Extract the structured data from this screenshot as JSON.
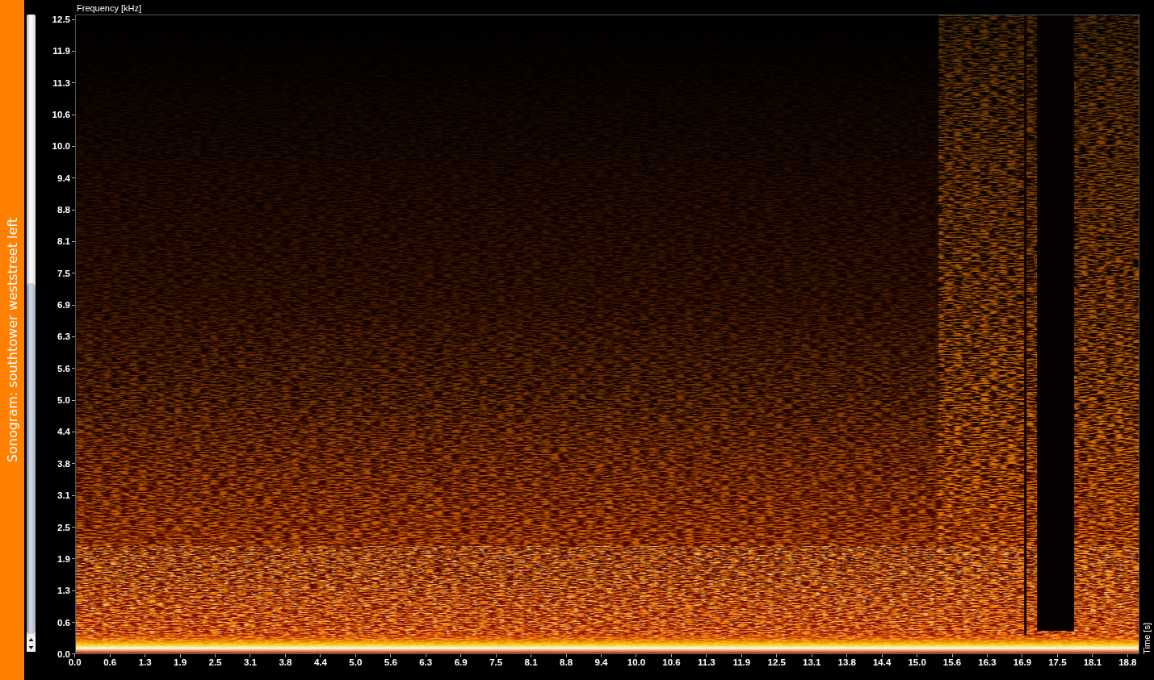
{
  "sidebar": {
    "title": "Sonogram: southtower weststreet left"
  },
  "chart": {
    "y_axis_label": "Frequency [kHz]",
    "y_ticks": [
      "12.5",
      "11.9",
      "11.3",
      "10.6",
      "10.0",
      "9.4",
      "8.8",
      "8.1",
      "7.5",
      "6.9",
      "6.3",
      "5.6",
      "5.0",
      "4.4",
      "3.8",
      "3.1",
      "2.5",
      "1.9",
      "1.3",
      "0.6",
      "0.0"
    ],
    "x_axis_label": "Time [s]",
    "x_ticks": [
      "0.0",
      "0.6",
      "1.3",
      "1.9",
      "2.5",
      "3.1",
      "3.8",
      "4.4",
      "5.0",
      "5.6",
      "6.3",
      "6.9",
      "7.5",
      "8.1",
      "8.8",
      "9.4",
      "10.0",
      "10.6",
      "11.3",
      "11.9",
      "12.5",
      "13.1",
      "13.8",
      "14.4",
      "15.0",
      "15.6",
      "16.3",
      "16.9",
      "17.5",
      "18.1",
      "18.8"
    ]
  }
}
